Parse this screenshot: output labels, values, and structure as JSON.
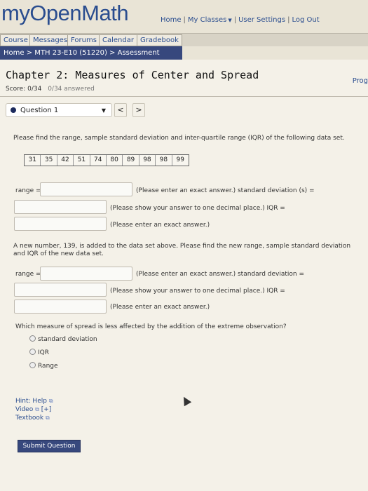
{
  "header": {
    "logo": "myOpenMath",
    "links": {
      "home": "Home",
      "my_classes": "My Classes",
      "user_settings": "User Settings",
      "log_out": "Log Out"
    }
  },
  "nav": {
    "course": "Course",
    "messages": "Messages",
    "forums": "Forums",
    "calendar": "Calendar",
    "gradebook": "Gradebook"
  },
  "breadcrumb": "Home > MTH 23-E10 (51220) > Assessment",
  "assessment": {
    "title": "Chapter 2: Measures of Center and Spread",
    "progress_label": "Prog",
    "score": "Score: 0/34",
    "answered": "0/34 answered"
  },
  "question_nav": {
    "selected": "Question 1",
    "prev": "<",
    "next": ">"
  },
  "question": {
    "prompt": "Please find the range, sample standard deviation and inter-quartile range (IQR) of the following data set.",
    "data_set": [
      "31",
      "35",
      "42",
      "51",
      "74",
      "80",
      "89",
      "98",
      "98",
      "99"
    ],
    "part1": {
      "range_label": "range =",
      "range_note": "(Please enter an exact answer.) standard deviation (s) =",
      "sd_note": "(Please show your answer to one decimal place.) IQR =",
      "iqr_note": "(Please enter an exact answer.)"
    },
    "prompt2": "A new number, 139, is added to the data set above. Please find the new range, sample standard deviation and IQR of the new data set.",
    "part2": {
      "range_label": "range =",
      "range_note": "(Please enter an exact answer.) standard deviation =",
      "sd_note": "(Please show your answer to one decimal place.) IQR =",
      "iqr_note": "(Please enter an exact answer.)"
    },
    "prompt3": "Which measure of spread is less affected by the addition of the extreme observation?",
    "options": [
      "standard deviation",
      "IQR",
      "Range"
    ]
  },
  "hints": {
    "hint_label": "Hint:",
    "help": "Help",
    "video": "Video",
    "video_expand": "[+]",
    "textbook": "Textbook"
  },
  "submit_label": "Submit Question"
}
